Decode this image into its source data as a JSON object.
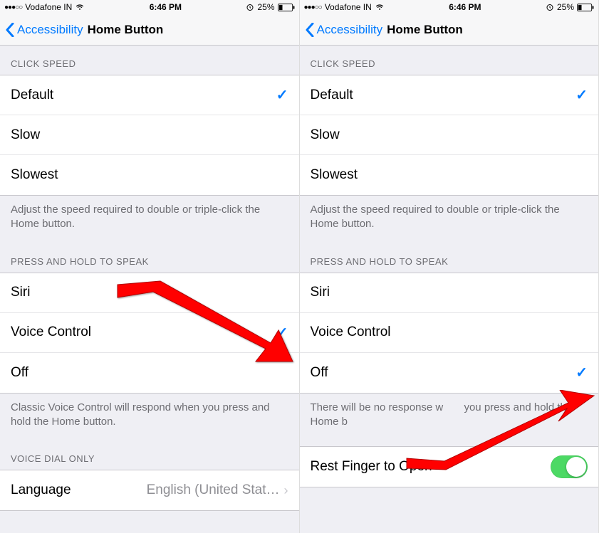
{
  "status": {
    "carrier": "Vodafone IN",
    "time": "6:46 PM",
    "battery_pct": "25%"
  },
  "nav": {
    "back": "Accessibility",
    "title": "Home Button"
  },
  "sections": {
    "click_speed": {
      "header": "CLICK SPEED",
      "options": {
        "default": "Default",
        "slow": "Slow",
        "slowest": "Slowest"
      },
      "footer": "Adjust the speed required to double or triple-click the Home button."
    },
    "press_hold": {
      "header": "PRESS AND HOLD TO SPEAK",
      "options": {
        "siri": "Siri",
        "voice": "Voice Control",
        "off": "Off"
      },
      "footer_voice": "Classic Voice Control will respond when you press and hold the Home button.",
      "footer_off_a": "There will be no response w",
      "footer_off_b": "you press and hold the Home b"
    },
    "voice_dial": {
      "header": "VOICE DIAL ONLY",
      "language_label": "Language",
      "language_value": "English (United Stat…"
    },
    "rest_finger": {
      "label": "Rest Finger to Open"
    }
  }
}
